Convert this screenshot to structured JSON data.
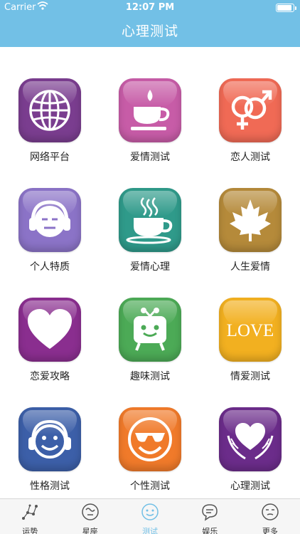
{
  "status_bar": {
    "carrier": "Carrier",
    "time": "12:07 PM"
  },
  "header": {
    "title": "心理测试"
  },
  "tiles": [
    {
      "label": "网络平台",
      "icon": "globe-icon",
      "color": "#7a3d8f"
    },
    {
      "label": "爱情测试",
      "icon": "coffee-cup-icon",
      "color": "#c75ca7"
    },
    {
      "label": "恋人测试",
      "icon": "gender-symbols-icon",
      "color": "#f06a55"
    },
    {
      "label": "个人特质",
      "icon": "headphone-face-icon",
      "color": "#8b73c7"
    },
    {
      "label": "爱情心理",
      "icon": "steaming-cup-icon",
      "color": "#2f9a8a"
    },
    {
      "label": "人生爱情",
      "icon": "maple-leaf-icon",
      "color": "#b58a3a"
    },
    {
      "label": "恋爱攻略",
      "icon": "heart-icon",
      "color": "#8a2e8f"
    },
    {
      "label": "趣味测试",
      "icon": "tv-robot-icon",
      "color": "#4caa56"
    },
    {
      "label": "情爱测试",
      "icon": "love-text-icon",
      "color": "#f2b020",
      "text": "LOVE"
    },
    {
      "label": "性格测试",
      "icon": "smiley-headphones-icon",
      "color": "#3c5fa8"
    },
    {
      "label": "个性测试",
      "icon": "cool-smiley-icon",
      "color": "#f07a2a"
    },
    {
      "label": "心理测试",
      "icon": "hands-heart-icon",
      "color": "#6b2c8a"
    }
  ],
  "tabbar": {
    "items": [
      {
        "label": "运势",
        "icon": "constellation-icon",
        "active": false
      },
      {
        "label": "星座",
        "icon": "zodiac-icon",
        "active": false
      },
      {
        "label": "测试",
        "icon": "smile-face-icon",
        "active": true
      },
      {
        "label": "娱乐",
        "icon": "chat-bubble-icon",
        "active": false
      },
      {
        "label": "更多",
        "icon": "more-face-icon",
        "active": false
      }
    ]
  },
  "colors": {
    "header": "#72c0e6",
    "tab_active": "#72c0e6"
  }
}
